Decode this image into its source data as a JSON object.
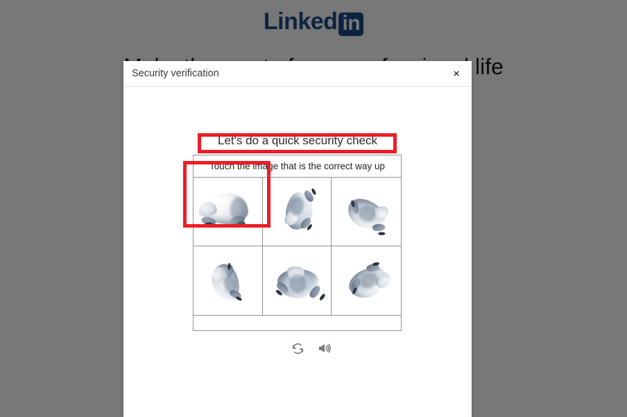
{
  "page": {
    "brand": {
      "word": "Linked",
      "badge": "in",
      "icon": "linkedin-logo"
    },
    "headline": "Make the most of your professional life"
  },
  "dialog": {
    "title": "Security verification",
    "close_label": "×",
    "heading": "Let's do a quick security check"
  },
  "captcha": {
    "prompt": "Touch the image that is the correct way up",
    "tiles": [
      {
        "id": "tile-1",
        "alt": "3D frog model upright",
        "pose": "pose-1",
        "selected": true
      },
      {
        "id": "tile-2",
        "alt": "3D frog model rotated 98 degrees",
        "pose": "pose-2",
        "selected": false
      },
      {
        "id": "tile-3",
        "alt": "3D frog model rotated 205 degrees",
        "pose": "pose-3",
        "selected": false
      },
      {
        "id": "tile-4",
        "alt": "3D frog model rotated 252 degrees",
        "pose": "pose-4",
        "selected": false
      },
      {
        "id": "tile-5",
        "alt": "3D frog model rotated 178 degrees",
        "pose": "pose-5",
        "selected": false
      },
      {
        "id": "tile-6",
        "alt": "3D frog model rotated 152 degrees",
        "pose": "pose-6",
        "selected": false
      }
    ],
    "controls": [
      {
        "id": "refresh",
        "icon": "refresh-icon",
        "label": "Get a new challenge"
      },
      {
        "id": "audio",
        "icon": "speaker-icon",
        "label": "Get an audio challenge"
      }
    ]
  },
  "annotations": [
    {
      "id": "prompt-highlight",
      "color": "#ee1c25",
      "target": "captcha-prompt"
    },
    {
      "id": "answer-highlight",
      "color": "#ee1c25",
      "target": "captcha-tile-1"
    }
  ],
  "colors": {
    "brand": "#1b4e86",
    "scrim": "rgba(0,0,0,0.53)",
    "annotation": "#ee1c25"
  }
}
